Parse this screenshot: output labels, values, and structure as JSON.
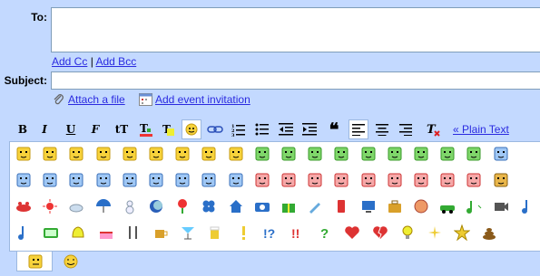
{
  "to": {
    "label": "To:",
    "value": ""
  },
  "links": {
    "add_cc": "Add Cc",
    "sep": "|",
    "add_bcc": "Add Bcc"
  },
  "subject": {
    "label": "Subject:",
    "value": ""
  },
  "attach": {
    "attach_file": "Attach a file",
    "add_event": "Add event invitation"
  },
  "toolbar": {
    "bold": "B",
    "italic": "I",
    "underline": "U",
    "font": "F",
    "size": "tT",
    "plain_text": "« Plain Text"
  },
  "emoticons": {
    "row1": [
      "yellow-face",
      "yellow-face",
      "yellow-face",
      "yellow-face",
      "yellow-face",
      "yellow-face",
      "yellow-face",
      "yellow-face",
      "yellow-face",
      "green-face",
      "green-face",
      "green-face",
      "green-face",
      "green-face",
      "green-face",
      "green-face",
      "green-face",
      "green-face",
      "blue-face"
    ],
    "row2": [
      "blue-face",
      "blue-face",
      "blue-face",
      "blue-face",
      "blue-face",
      "blue-face",
      "blue-face",
      "blue-face",
      "blue-face",
      "red-face",
      "red-face",
      "red-face",
      "red-face",
      "red-face",
      "red-face",
      "red-face",
      "red-face",
      "red-face",
      "orange-face"
    ],
    "row3": [
      "crab",
      "sun",
      "cloud",
      "umbrella",
      "snowman",
      "moon",
      "flower",
      "clover",
      "house",
      "camera",
      "gift",
      "pencil",
      "phone",
      "computer",
      "briefcase",
      "ball",
      "car",
      "music-note",
      "film",
      "note"
    ],
    "row4": [
      "note",
      "tv",
      "bell",
      "cake",
      "utensils",
      "cup",
      "cocktail",
      "beer",
      "exclamation",
      "question-exclaim",
      "double-exclaim",
      "question",
      "heart",
      "broken-heart",
      "bulb",
      "sparkle",
      "star",
      "poop"
    ]
  },
  "tabs": [
    "emoticon-tab-1",
    "emoticon-tab-2"
  ]
}
